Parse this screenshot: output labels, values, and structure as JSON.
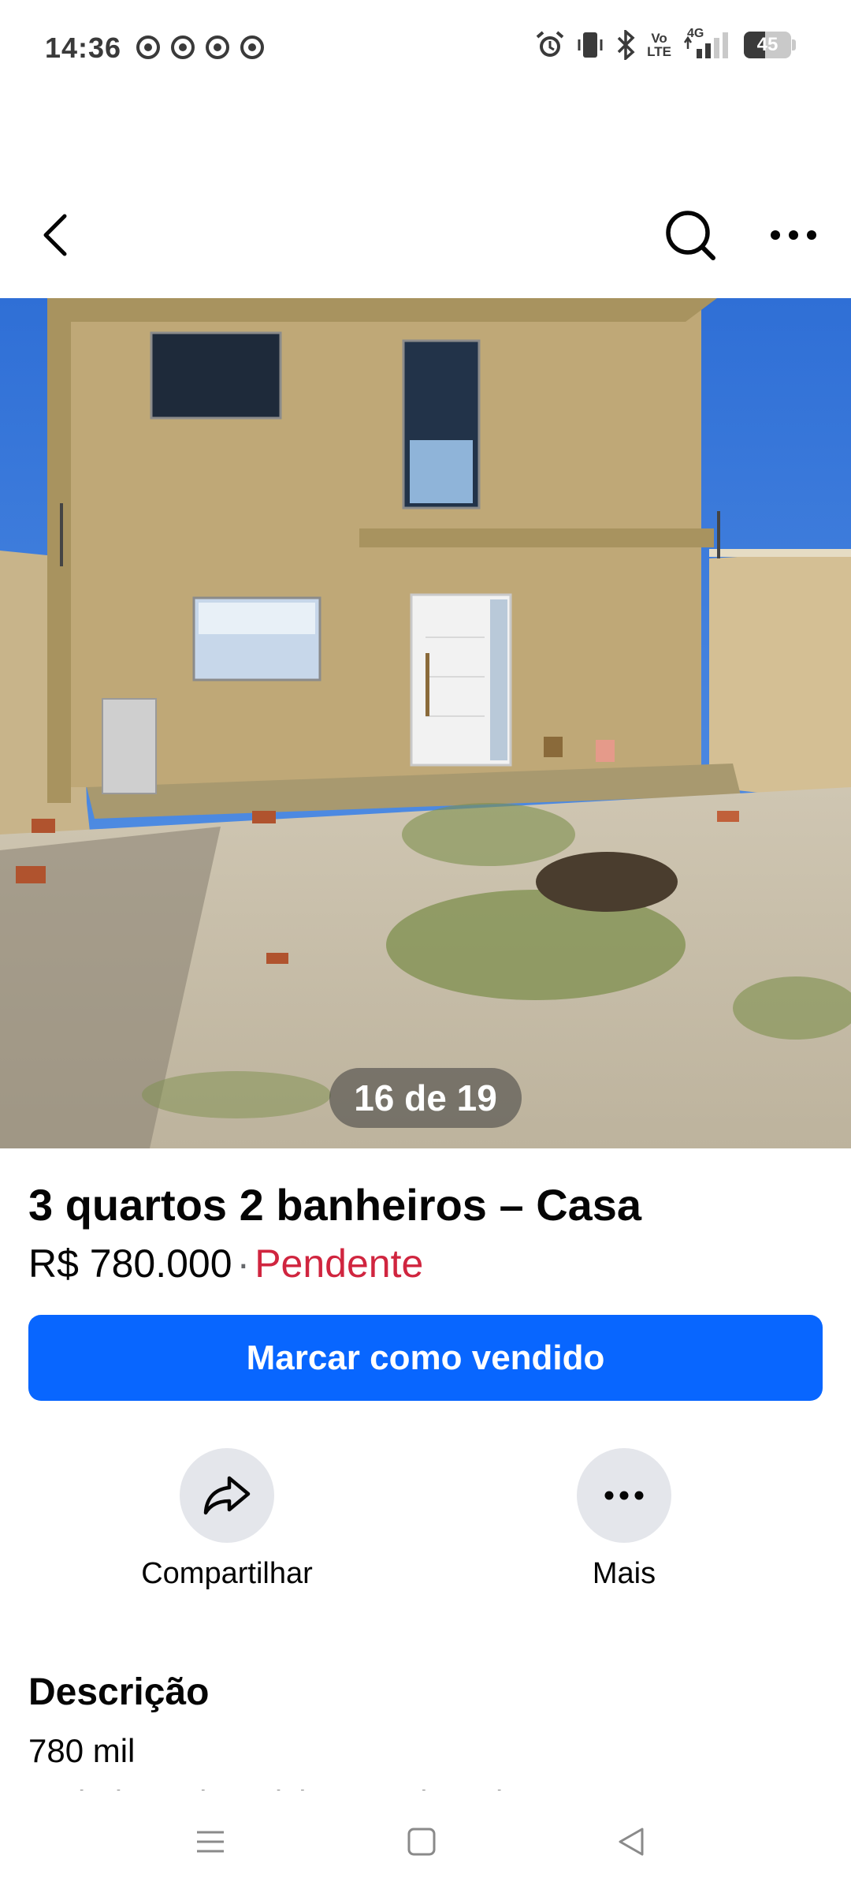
{
  "status_bar": {
    "time": "14:36",
    "network": "4G",
    "volte_line1": "Vo",
    "volte_line2": "LTE",
    "battery_level": 45,
    "battery_text": "45"
  },
  "photo": {
    "counter": "16 de 19"
  },
  "listing": {
    "title": "3 quartos 2 banheiros – Casa",
    "price": "R$ 780.000",
    "separator": "·",
    "status": "Pendente",
    "status_color": "#d0253f"
  },
  "primary_action": {
    "label": "Marcar como vendido",
    "color": "#0866ff"
  },
  "actions": [
    {
      "label": "Compartilhar",
      "icon": "share-icon"
    },
    {
      "label": "Mais",
      "icon": "more-icon"
    }
  ],
  "description": {
    "heading": "Descrição",
    "line1": "780 mil",
    "line2": "Ao lado Arpina Piçinas Praia Bela"
  }
}
